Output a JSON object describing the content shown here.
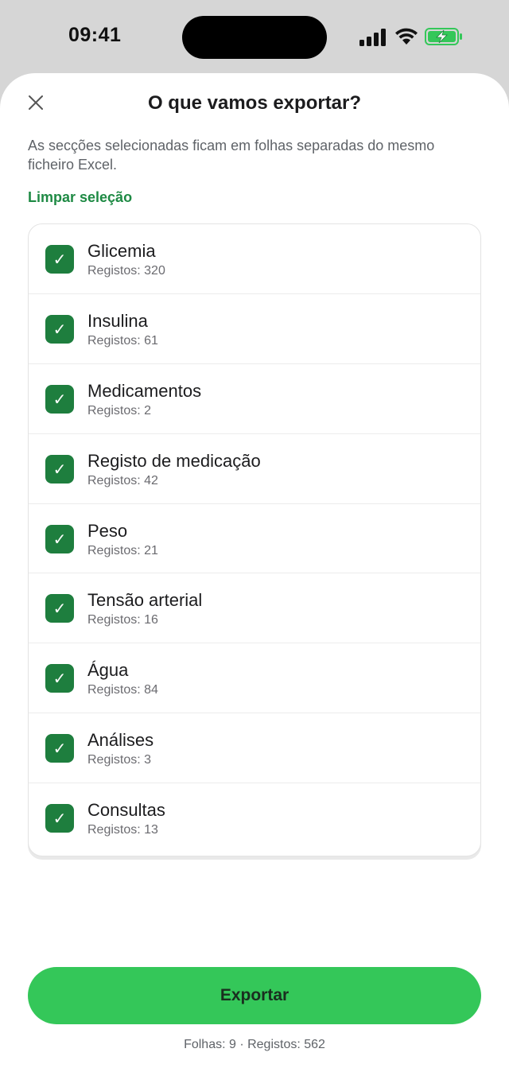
{
  "status_bar": {
    "time": "09:41",
    "icons": [
      "signal-icon",
      "wifi-icon",
      "battery-charging-icon"
    ],
    "battery_color": "#34c759"
  },
  "sheet": {
    "close_icon": "close-icon",
    "title": "O que vamos exportar?",
    "subtitle": "As secções selecionadas ficam em folhas separadas do mesmo ficheiro Excel.",
    "clear_selection": "Limpar seleção"
  },
  "sections": [
    {
      "label": "Glicemia",
      "count": "Registos: 320",
      "checked": true
    },
    {
      "label": "Insulina",
      "count": "Registos: 61",
      "checked": true
    },
    {
      "label": "Medicamentos",
      "count": "Registos: 2",
      "checked": true
    },
    {
      "label": "Registo de medicação",
      "count": "Registos: 42",
      "checked": true
    },
    {
      "label": "Peso",
      "count": "Registos: 21",
      "checked": true
    },
    {
      "label": "Tensão arterial",
      "count": "Registos: 16",
      "checked": true
    },
    {
      "label": "Água",
      "count": "Registos: 84",
      "checked": true
    },
    {
      "label": "Análises",
      "count": "Registos: 3",
      "checked": true
    },
    {
      "label": "Consultas",
      "count": "Registos: 13",
      "checked": true
    }
  ],
  "checkmark": "✓",
  "export_button": "Exportar",
  "footer_summary": "Folhas: 9 · Registos: 562",
  "colors": {
    "accent_green": "#1e8a44",
    "checkbox_green": "#1e7e3e",
    "button_green": "#34c759"
  }
}
